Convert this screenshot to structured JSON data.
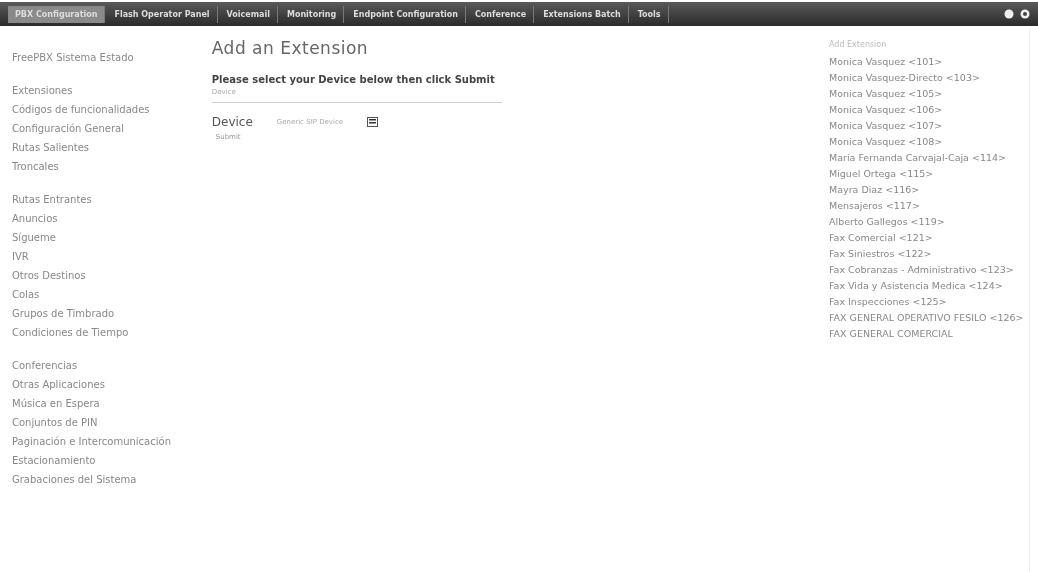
{
  "tabs": [
    {
      "label": "PBX Configuration",
      "selected": true
    },
    {
      "label": "Flash Operator Panel",
      "selected": false
    },
    {
      "label": "Voicemail",
      "selected": false
    },
    {
      "label": "Monitoring",
      "selected": false
    },
    {
      "label": "Endpoint Configuration",
      "selected": false
    },
    {
      "label": "Conference",
      "selected": false
    },
    {
      "label": "Extensions Batch",
      "selected": false
    },
    {
      "label": "Tools",
      "selected": false
    }
  ],
  "sidebar": {
    "groups": [
      [
        "FreePBX Sistema Estado"
      ],
      [
        "Extensiones",
        "Códigos de funcionalidades",
        "Configuración General",
        "Rutas Salientes",
        "Troncales"
      ],
      [
        "Rutas Entrantes",
        "Anuncios",
        "Sígueme",
        "IVR",
        "Otros Destinos",
        "Colas",
        "Grupos de Timbrado",
        "Condiciones de Tiempo"
      ],
      [
        "Conferencias",
        "Otras Aplicaciones",
        "Música en Espera",
        "Conjuntos de PIN",
        "Paginación e Intercomunicación",
        "Estacionamiento",
        "Grabaciones del Sistema"
      ]
    ]
  },
  "main": {
    "title": "Add an Extension",
    "instruction": "Please select your Device below then click Submit",
    "legend": "Device",
    "device_label": "Device",
    "device_value": "Generic SIP Device",
    "submit": "Submit"
  },
  "extensions": {
    "heading": "Add Extension",
    "items": [
      "Monica Vasquez <101>",
      "Monica Vasquez-Directo <103>",
      "Monica Vasquez <105>",
      "Monica Vasquez <106>",
      "Monica Vasquez <107>",
      "Monica Vasquez <108>",
      "Maria Fernanda Carvajal-Caja <114>",
      "Miguel Ortega <115>",
      "Mayra Diaz <116>",
      "Mensajeros <117>",
      "Alberto Gallegos <119>",
      "Fax Comercial <121>",
      "Fax Siniestros <122>",
      "Fax Cobranzas - Administrativo <123>",
      "Fax Vida y Asistencia Medica <124>",
      "Fax Inspecciones <125>",
      "FAX GENERAL OPERATIVO FESILO <126>",
      "FAX GENERAL COMERCIAL"
    ]
  }
}
